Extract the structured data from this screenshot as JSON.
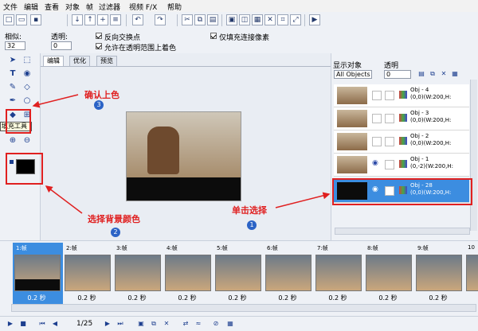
{
  "menu": [
    "文件",
    "编辑",
    "查看",
    "对象",
    "帧",
    "过滤器",
    "视频 F/X",
    "帮助"
  ],
  "props": {
    "tolerance_label": "相似:",
    "tolerance_value": "32",
    "opacity_label": "透明:",
    "opacity_value": "0",
    "checkbox_antialias": "反向交换点",
    "checkbox_transparent": "允许在透明范围上着色",
    "checkbox_contiguous": "仅填充连接像素"
  },
  "tooltip": "填充工具",
  "editor_tabs": [
    "编辑",
    "优化",
    "预览"
  ],
  "objects": {
    "show_label": "显示对象",
    "opacity_label": "透明",
    "filter_value": "All Objects",
    "opacity_value": "0",
    "rows": [
      {
        "name": "Obj - 4",
        "info": "(0,0)(W:200,H:"
      },
      {
        "name": "Obj - 3",
        "info": "(0,0)(W:200,H:"
      },
      {
        "name": "Obj - 2",
        "info": "(0,0)(W:200,H:"
      },
      {
        "name": "Obj - 1",
        "info": "(0,-2)(W:200,H:"
      },
      {
        "name": "Obj - 28",
        "info": "(0,0)(W:200,H:"
      }
    ]
  },
  "frames": [
    {
      "label": "1:帧",
      "duration": "0.2 秒"
    },
    {
      "label": "2:帧",
      "duration": "0.2 秒"
    },
    {
      "label": "3:帧",
      "duration": "0.2 秒"
    },
    {
      "label": "4:帧",
      "duration": "0.2 秒"
    },
    {
      "label": "5:帧",
      "duration": "0.2 秒"
    },
    {
      "label": "6:帧",
      "duration": "0.2 秒"
    },
    {
      "label": "7:帧",
      "duration": "0.2 秒"
    },
    {
      "label": "8:帧",
      "duration": "0.2 秒"
    },
    {
      "label": "9:帧",
      "duration": "0.2 秒"
    },
    {
      "label": "10",
      "duration": "0.2 秒"
    }
  ],
  "statusbar": {
    "frame_counter": "1/25"
  },
  "annotations": {
    "confirm_color": "确认上色",
    "pick_bg_color": "选择背景颜色",
    "click_select": "单击选择",
    "badge1": "1",
    "badge2": "2",
    "badge3": "3"
  },
  "colors": {
    "accent": "#3c8de0",
    "annotation": "#e02020",
    "badge": "#2b63c6"
  }
}
